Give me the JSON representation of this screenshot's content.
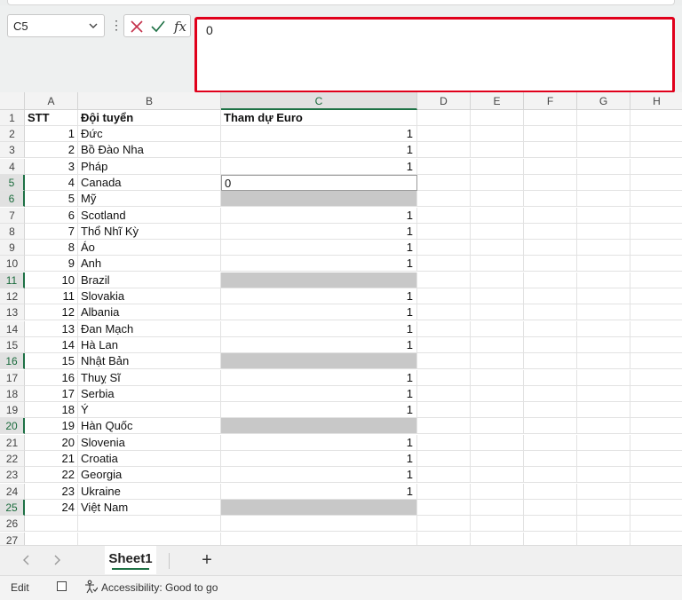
{
  "name_box": "C5",
  "formula_value": "0",
  "columns": [
    "A",
    "B",
    "C",
    "D",
    "E",
    "F",
    "G",
    "H"
  ],
  "selected_column": "C",
  "header_row": {
    "row": "1",
    "a": "STT",
    "b": "Đội tuyển",
    "c": "Tham dự Euro"
  },
  "rows": [
    {
      "row": "2",
      "a": "1",
      "b": "Đức",
      "c": "1"
    },
    {
      "row": "3",
      "a": "2",
      "b": "Bồ Đào Nha",
      "c": "1"
    },
    {
      "row": "4",
      "a": "3",
      "b": "Pháp",
      "c": "1"
    },
    {
      "row": "5",
      "a": "4",
      "b": "Canada",
      "c": "0",
      "active": true
    },
    {
      "row": "6",
      "a": "5",
      "b": "Mỹ",
      "c": "",
      "gray": true
    },
    {
      "row": "7",
      "a": "6",
      "b": "Scotland",
      "c": "1"
    },
    {
      "row": "8",
      "a": "7",
      "b": "Thổ Nhĩ Kỳ",
      "c": "1"
    },
    {
      "row": "9",
      "a": "8",
      "b": "Áo",
      "c": "1"
    },
    {
      "row": "10",
      "a": "9",
      "b": "Anh",
      "c": "1"
    },
    {
      "row": "11",
      "a": "10",
      "b": "Brazil",
      "c": "",
      "gray": true
    },
    {
      "row": "12",
      "a": "11",
      "b": "Slovakia",
      "c": "1"
    },
    {
      "row": "13",
      "a": "12",
      "b": "Albania",
      "c": "1"
    },
    {
      "row": "14",
      "a": "13",
      "b": "Đan Mạch",
      "c": "1"
    },
    {
      "row": "15",
      "a": "14",
      "b": "Hà Lan",
      "c": "1"
    },
    {
      "row": "16",
      "a": "15",
      "b": "Nhật Bản",
      "c": "",
      "gray": true
    },
    {
      "row": "17",
      "a": "16",
      "b": "Thuỵ Sĩ",
      "c": "1"
    },
    {
      "row": "18",
      "a": "17",
      "b": "Serbia",
      "c": "1"
    },
    {
      "row": "19",
      "a": "18",
      "b": "Ý",
      "c": "1"
    },
    {
      "row": "20",
      "a": "19",
      "b": "Hàn Quốc",
      "c": "",
      "gray": true
    },
    {
      "row": "21",
      "a": "20",
      "b": "Slovenia",
      "c": "1"
    },
    {
      "row": "22",
      "a": "21",
      "b": "Croatia",
      "c": "1"
    },
    {
      "row": "23",
      "a": "22",
      "b": "Georgia",
      "c": "1"
    },
    {
      "row": "24",
      "a": "23",
      "b": "Ukraine",
      "c": "1"
    },
    {
      "row": "25",
      "a": "24",
      "b": "Việt Nam",
      "c": "",
      "gray": true
    },
    {
      "row": "26",
      "a": "",
      "b": "",
      "c": ""
    },
    {
      "row": "27",
      "a": "",
      "b": "",
      "c": ""
    }
  ],
  "sheet_tab": "Sheet1",
  "add_sheet": "+",
  "status": {
    "mode": "Edit",
    "accessibility": "Accessibility: Good to go"
  },
  "icons": {
    "cancel": "close-icon",
    "enter": "check-icon",
    "function": "fx-icon"
  },
  "colors": {
    "accent": "#1e7145",
    "formula_border": "#e0001b",
    "gray_cell": "#c8c8c8"
  }
}
